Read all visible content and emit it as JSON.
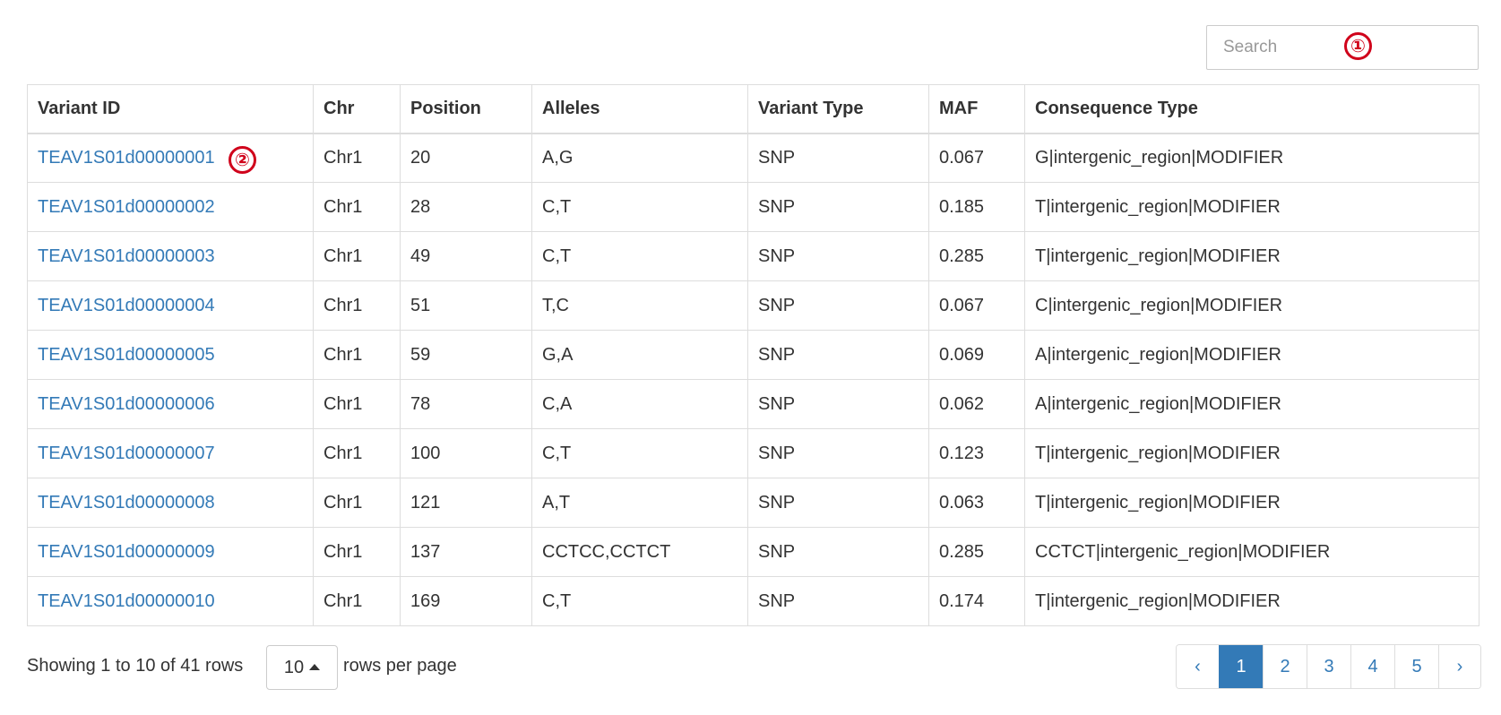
{
  "search": {
    "placeholder": "Search",
    "value": ""
  },
  "annotations": {
    "marker_1": "①",
    "marker_2": "②",
    "color": "#d0021b"
  },
  "table": {
    "columns": [
      "Variant ID",
      "Chr",
      "Position",
      "Alleles",
      "Variant Type",
      "MAF",
      "Consequence Type"
    ],
    "rows": [
      {
        "variant_id": "TEAV1S01d00000001",
        "chr": "Chr1",
        "position": "20",
        "alleles": "A,G",
        "variant_type": "SNP",
        "maf": "0.067",
        "consequence": "G|intergenic_region|MODIFIER"
      },
      {
        "variant_id": "TEAV1S01d00000002",
        "chr": "Chr1",
        "position": "28",
        "alleles": "C,T",
        "variant_type": "SNP",
        "maf": "0.185",
        "consequence": "T|intergenic_region|MODIFIER"
      },
      {
        "variant_id": "TEAV1S01d00000003",
        "chr": "Chr1",
        "position": "49",
        "alleles": "C,T",
        "variant_type": "SNP",
        "maf": "0.285",
        "consequence": "T|intergenic_region|MODIFIER"
      },
      {
        "variant_id": "TEAV1S01d00000004",
        "chr": "Chr1",
        "position": "51",
        "alleles": "T,C",
        "variant_type": "SNP",
        "maf": "0.067",
        "consequence": "C|intergenic_region|MODIFIER"
      },
      {
        "variant_id": "TEAV1S01d00000005",
        "chr": "Chr1",
        "position": "59",
        "alleles": "G,A",
        "variant_type": "SNP",
        "maf": "0.069",
        "consequence": "A|intergenic_region|MODIFIER"
      },
      {
        "variant_id": "TEAV1S01d00000006",
        "chr": "Chr1",
        "position": "78",
        "alleles": "C,A",
        "variant_type": "SNP",
        "maf": "0.062",
        "consequence": "A|intergenic_region|MODIFIER"
      },
      {
        "variant_id": "TEAV1S01d00000007",
        "chr": "Chr1",
        "position": "100",
        "alleles": "C,T",
        "variant_type": "SNP",
        "maf": "0.123",
        "consequence": "T|intergenic_region|MODIFIER"
      },
      {
        "variant_id": "TEAV1S01d00000008",
        "chr": "Chr1",
        "position": "121",
        "alleles": "A,T",
        "variant_type": "SNP",
        "maf": "0.063",
        "consequence": "T|intergenic_region|MODIFIER"
      },
      {
        "variant_id": "TEAV1S01d00000009",
        "chr": "Chr1",
        "position": "137",
        "alleles": "CCTCC,CCTCT",
        "variant_type": "SNP",
        "maf": "0.285",
        "consequence": "CCTCT|intergenic_region|MODIFIER"
      },
      {
        "variant_id": "TEAV1S01d00000010",
        "chr": "Chr1",
        "position": "169",
        "alleles": "C,T",
        "variant_type": "SNP",
        "maf": "0.174",
        "consequence": "T|intergenic_region|MODIFIER"
      }
    ]
  },
  "footer": {
    "showing_text": "Showing 1 to 10 of 41 rows",
    "page_size": "10",
    "rows_per_page_text": "rows per page"
  },
  "pagination": {
    "prev": "‹",
    "next": "›",
    "pages": [
      "1",
      "2",
      "3",
      "4",
      "5"
    ],
    "active_page": "1",
    "accent_color": "#337ab7"
  }
}
